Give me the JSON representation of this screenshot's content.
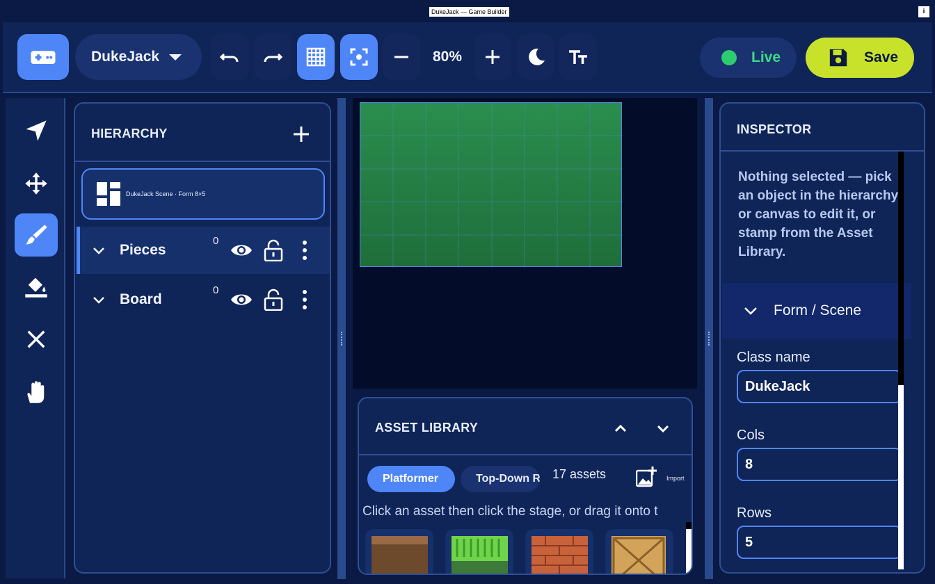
{
  "window": {
    "title": "DukeJack — Game Builder",
    "info_label": "i"
  },
  "toolbar": {
    "project_name": "DukeJack",
    "zoom": "80%",
    "live_label": "Live",
    "save_label": "Save",
    "icons": [
      "gamepad-icon",
      "undo-icon",
      "redo-icon",
      "grid-icon",
      "focus-icon",
      "zoom-out-icon",
      "zoom-in-icon",
      "moon-icon",
      "text-size-icon"
    ],
    "active_toggles": [
      "grid",
      "focus"
    ]
  },
  "rail": {
    "tools": [
      "select",
      "move",
      "brush",
      "fill",
      "erase",
      "pan"
    ],
    "active_tool": "brush"
  },
  "hierarchy": {
    "title": "HIERARCHY",
    "scene_label": "DukeJack Scene · Form 8×5",
    "layers": [
      {
        "name": "Pieces",
        "count": "0",
        "selected": true
      },
      {
        "name": "Board",
        "count": "0",
        "selected": false
      }
    ]
  },
  "canvas": {
    "cols": 8,
    "rows": 5,
    "stage_color": "#2a8e4e"
  },
  "assets": {
    "title": "ASSET LIBRARY",
    "tabs": [
      "Platformer",
      "Top-Down R"
    ],
    "count_label": "17 assets",
    "import_label": "Import",
    "hint": "Click an asset then click the stage, or drag it onto t",
    "tiles": [
      "dirt-block",
      "grass-block",
      "brick-block",
      "wood-crate"
    ]
  },
  "inspector": {
    "title": "INSPECTOR",
    "note": "Nothing selected — pick an object in the hierarchy or canvas to edit it, or stamp from the Asset Library.",
    "section_title": "Form / Scene",
    "fields": [
      {
        "label": "Class name",
        "value": "DukeJack"
      },
      {
        "label": "Cols",
        "value": "8"
      },
      {
        "label": "Rows",
        "value": "5"
      }
    ]
  },
  "colors": {
    "accent": "#4f86f7",
    "save": "#c8e22b",
    "live": "#2ecc71",
    "background": "#0a1a45"
  }
}
